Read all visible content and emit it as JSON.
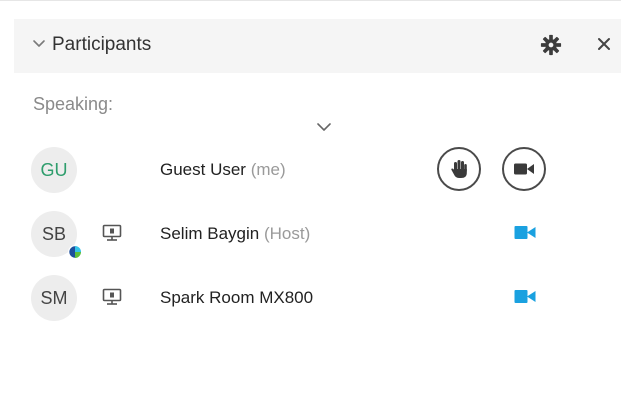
{
  "header": {
    "title": "Participants"
  },
  "speaking_label": "Speaking:",
  "participants": [
    {
      "initials": "GU",
      "name": "Guest User",
      "role": "(me)"
    },
    {
      "initials": "SB",
      "name": "Selim Baygin",
      "role": "(Host)"
    },
    {
      "initials": "SM",
      "name": "Spark Room MX800",
      "role": ""
    }
  ],
  "colors": {
    "accent_blue": "#1aa1e0",
    "guest_initials": "#2e9d6c",
    "header_bg": "#f5f5f5"
  },
  "icons": {
    "header": [
      "chevron-down-icon",
      "gear-icon",
      "close-icon"
    ],
    "row_actions": [
      "raise-hand-icon",
      "video-camera-icon",
      "screen-share-icon",
      "presence-badge-icon"
    ]
  }
}
